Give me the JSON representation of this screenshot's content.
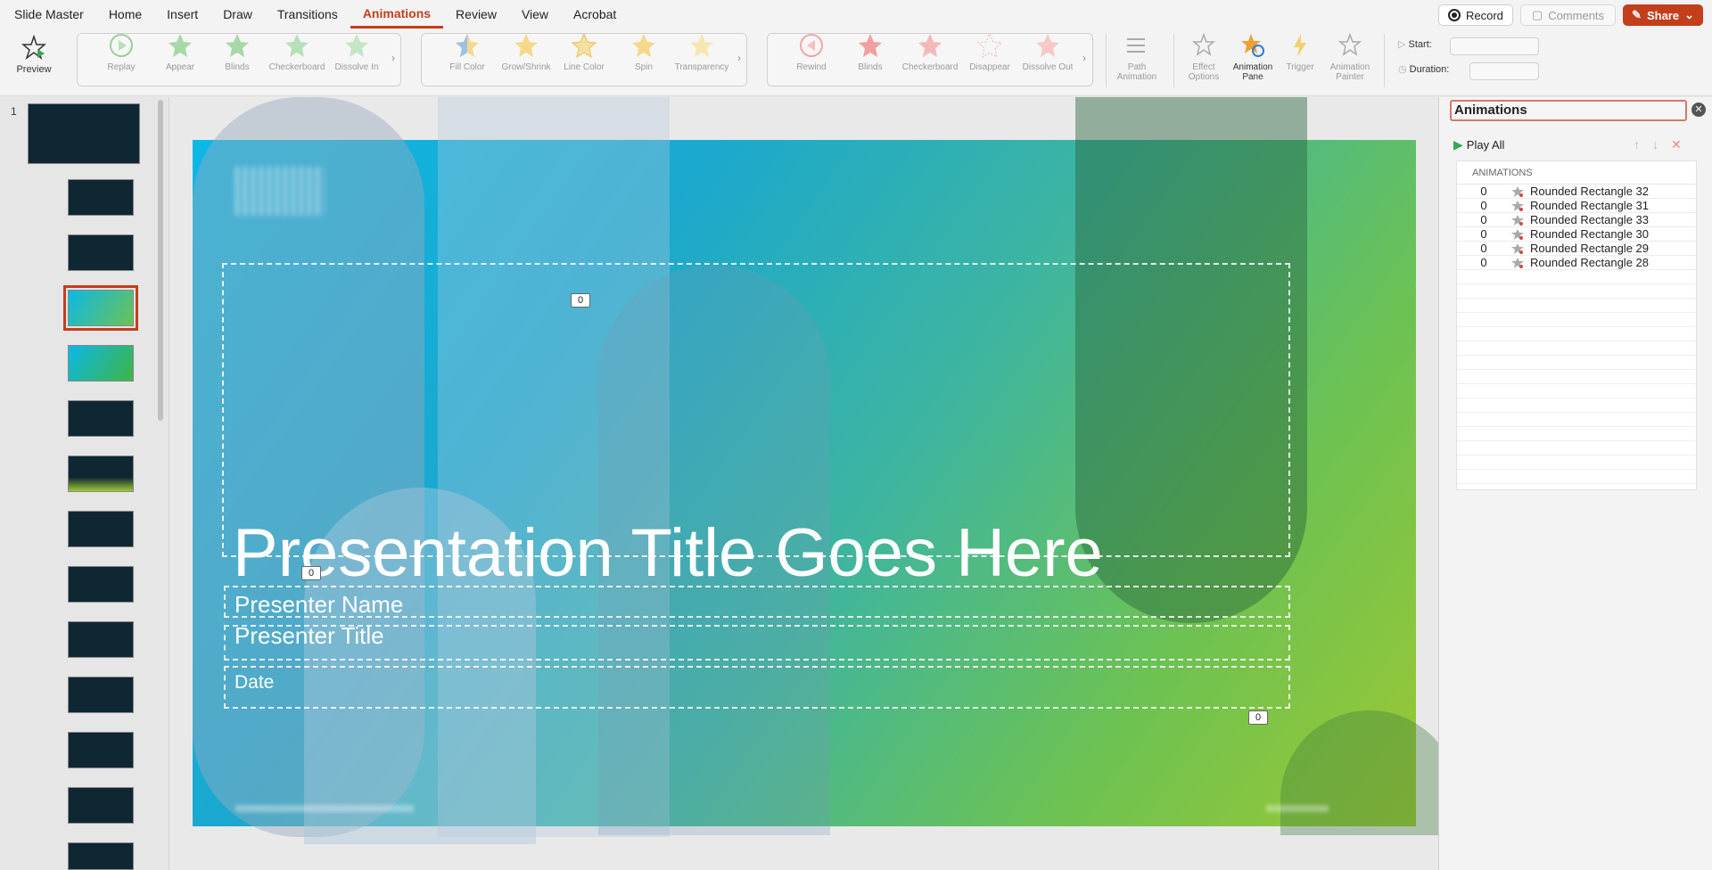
{
  "menu": {
    "tabs": [
      "Slide Master",
      "Home",
      "Insert",
      "Draw",
      "Transitions",
      "Animations",
      "Review",
      "View",
      "Acrobat"
    ],
    "active_tab": "Animations",
    "record_label": "Record",
    "comments_label": "Comments",
    "share_label": "Share"
  },
  "ribbon": {
    "preview_label": "Preview",
    "group1": [
      "Replay",
      "Appear",
      "Blinds",
      "Checkerboard",
      "Dissolve In"
    ],
    "group2": [
      "Fill Color",
      "Grow/Shrink",
      "Line Color",
      "Spin",
      "Transparency"
    ],
    "group3": [
      "Rewind",
      "Blinds",
      "Checkerboard",
      "Disappear",
      "Dissolve Out"
    ],
    "path_animation": "Path Animation",
    "effect_options": "Effect Options",
    "animation_pane": "Animation Pane",
    "trigger": "Trigger",
    "animation_painter": "Animation Painter",
    "start_label": "Start:",
    "duration_label": "Duration:"
  },
  "sidebar": {
    "slide_number": "1"
  },
  "slide": {
    "title": "Presentation Title Goes Here",
    "presenter_name": "Presenter Name",
    "presenter_title": "Presenter Title",
    "date": "Date",
    "tag_a": "0",
    "tag_b": "0",
    "tag_c": "0"
  },
  "pane": {
    "title": "Animations",
    "play_all": "Play All",
    "list_header": "ANIMATIONS",
    "items": [
      {
        "order": "0",
        "name": "Rounded Rectangle 32"
      },
      {
        "order": "0",
        "name": "Rounded Rectangle 31"
      },
      {
        "order": "0",
        "name": "Rounded Rectangle 33"
      },
      {
        "order": "0",
        "name": "Rounded Rectangle 30"
      },
      {
        "order": "0",
        "name": "Rounded Rectangle 29"
      },
      {
        "order": "0",
        "name": "Rounded Rectangle 28"
      }
    ]
  },
  "colors": {
    "accent": "#c43e1c",
    "star_green": "#5fae4c",
    "star_yellow": "#f0b429",
    "star_red": "#e06666"
  }
}
